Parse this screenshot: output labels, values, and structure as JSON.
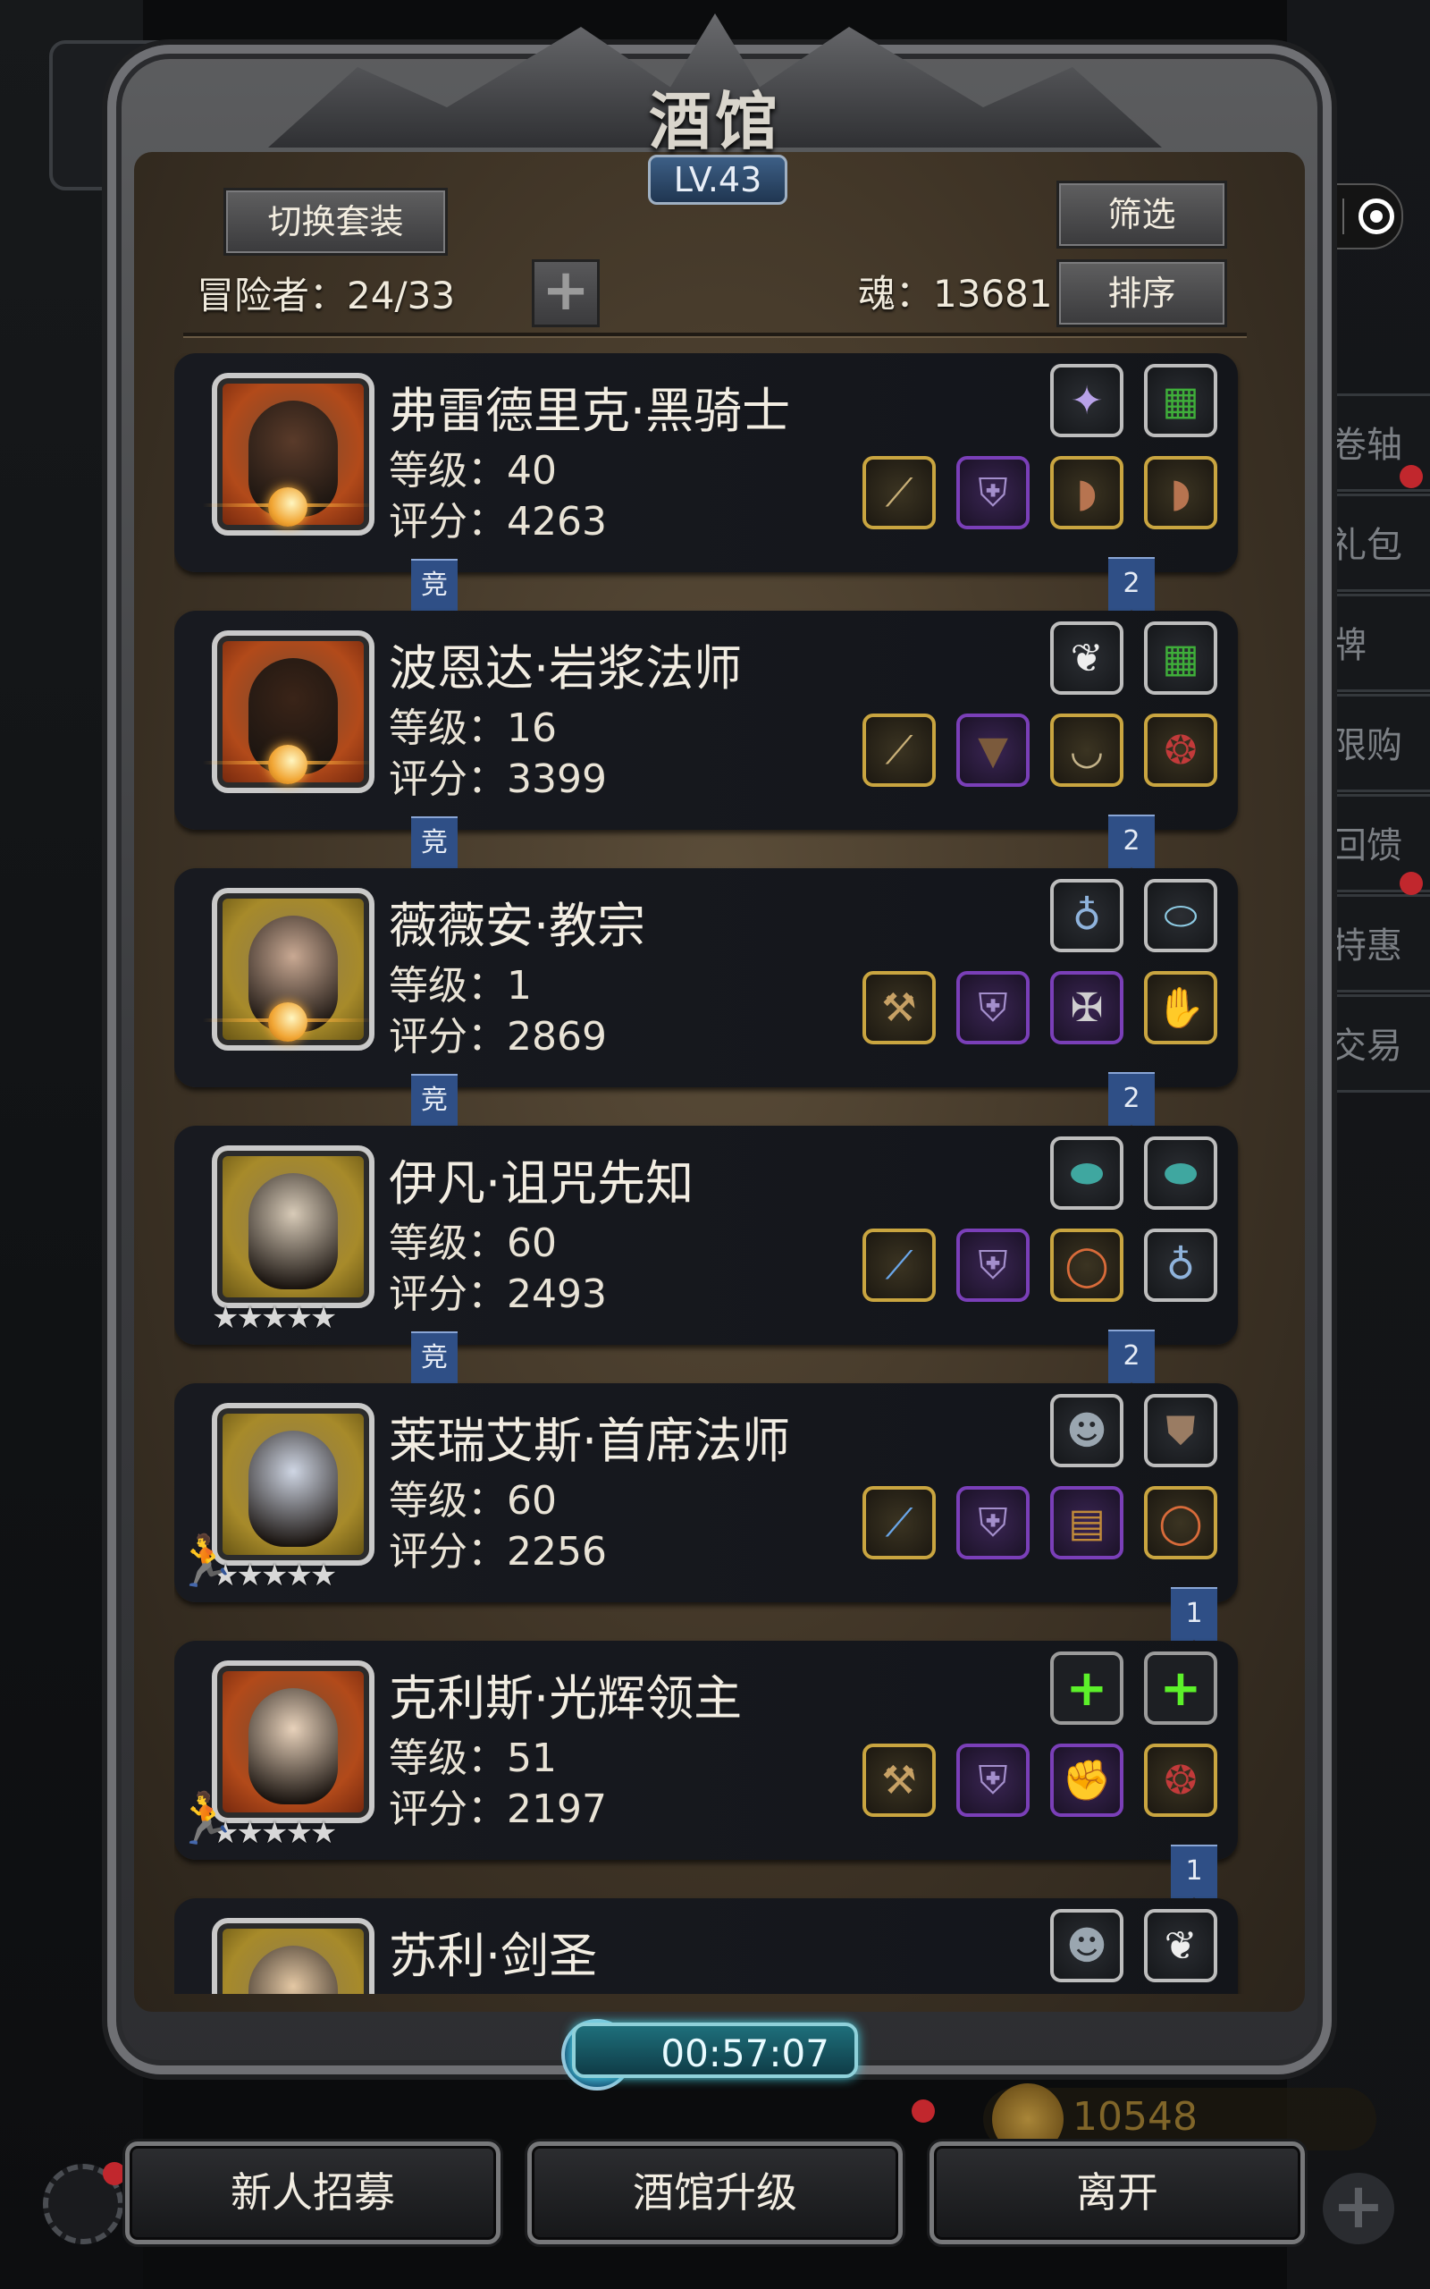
{
  "header": {
    "title": "酒馆",
    "level": "LV.43",
    "switch_set_label": "切换套装",
    "filter_label": "筛选",
    "sort_label": "排序",
    "adventurers": "冒险者：24/33",
    "soul": "魂：13681"
  },
  "capsule": {
    "more_icon": "•••"
  },
  "side_menu": [
    "卷轴",
    "礼包",
    "牌",
    "限购",
    "回馈",
    "特惠",
    "交易"
  ],
  "heroes": [
    {
      "name": "弗雷德里克·黑骑士",
      "level": "等级：40",
      "score": "评分：4263",
      "frame": "orange",
      "badge": "moon",
      "ribbon_left": "竞",
      "ribbon_right": "2",
      "top_slots": [
        "crystal",
        "green-card"
      ],
      "bottom_slots": [
        "staff",
        "armor",
        "boot",
        "boot"
      ]
    },
    {
      "name": "波恩达·岩浆法师",
      "level": "等级：16",
      "score": "评分：3399",
      "frame": "orange",
      "badge": "moon",
      "ribbon_left": "竞",
      "ribbon_right": "2",
      "top_slots": [
        "feather",
        "green-card"
      ],
      "bottom_slots": [
        "staff",
        "cloak",
        "necklace",
        "amulet"
      ]
    },
    {
      "name": "薇薇安·教宗",
      "level": "等级：1",
      "score": "评分：2869",
      "frame": "gold",
      "badge": "moon",
      "ribbon_left": "竞",
      "ribbon_right": "2",
      "top_slots": [
        "pendant",
        "scroll"
      ],
      "bottom_slots": [
        "hammer",
        "armor",
        "cross",
        "glove"
      ]
    },
    {
      "name": "伊凡·诅咒先知",
      "level": "等级：60",
      "score": "评分：2493",
      "frame": "gold",
      "badge": "stars",
      "ribbon_left": "竞",
      "ribbon_right": "2",
      "top_slots": [
        "gem",
        "gem"
      ],
      "bottom_slots": [
        "scepter",
        "armor",
        "ring",
        "pendant"
      ]
    },
    {
      "name": "莱瑞艾斯·首席法师",
      "level": "等级：60",
      "score": "评分：2256",
      "frame": "gold",
      "badge": "stars",
      "runner": true,
      "ribbon_right": "1",
      "top_slots": [
        "mask",
        "shield"
      ],
      "bottom_slots": [
        "scepter",
        "armor",
        "chest",
        "ring"
      ]
    },
    {
      "name": "克利斯·光辉领主",
      "level": "等级：51",
      "score": "评分：2197",
      "frame": "orange",
      "badge": "stars",
      "runner": true,
      "ribbon_right": "1",
      "top_slots": [
        "empty",
        "empty"
      ],
      "bottom_slots": [
        "hammer",
        "armor",
        "gauntlet",
        "amulet"
      ]
    },
    {
      "name": "苏利·剑圣",
      "level": "",
      "score": "",
      "frame": "gold",
      "badge": "",
      "top_slots": [
        "mask",
        "feather"
      ],
      "bottom_slots": []
    }
  ],
  "stars": "★★★★★",
  "timer": "00:57:07",
  "gold": "10548",
  "bottom_buttons": {
    "recruit": "新人招募",
    "upgrade": "酒馆升级",
    "leave": "离开"
  },
  "colors": {
    "accent_gold": "#c9a540",
    "purple_slot": "#7a3fb8",
    "ribbon_blue": "#2f4f86"
  }
}
